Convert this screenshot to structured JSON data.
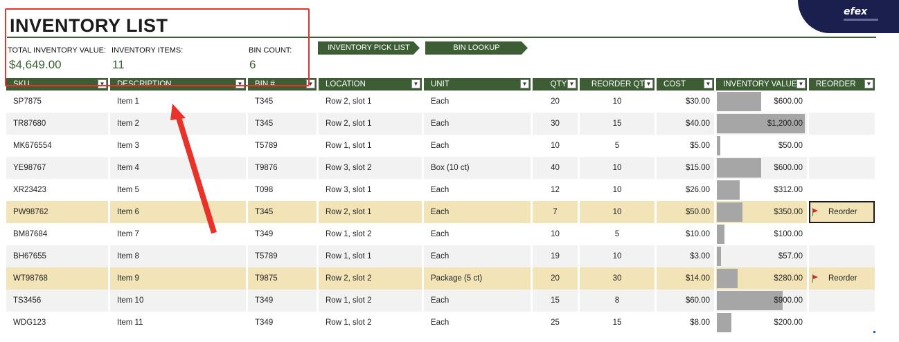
{
  "brand": {
    "logo_text": "efex"
  },
  "title": "INVENTORY LIST",
  "stats": {
    "total_value_label": "TOTAL INVENTORY VALUE:",
    "total_value": "$4,649.00",
    "items_label": "INVENTORY ITEMS:",
    "items": "11",
    "bins_label": "BIN COUNT:",
    "bins": "6"
  },
  "nav": {
    "pick_list": "INVENTORY PICK LIST",
    "bin_lookup": "BIN LOOKUP"
  },
  "colors": {
    "header_green": "#3d5e35",
    "reorder_row": "#f2e4b7",
    "annotation_red": "#e8332a",
    "logo_navy": "#1a1f4d"
  },
  "table": {
    "headers": [
      "SKU",
      "DESCRIPTION",
      "BIN #",
      "LOCATION",
      "UNIT",
      "QTY",
      "REORDER QTY",
      "COST",
      "INVENTORY VALUE",
      "REORDER"
    ],
    "max_value": 1200,
    "rows": [
      {
        "sku": "SP7875",
        "desc": "Item 1",
        "bin": "T345",
        "loc": "Row 2, slot 1",
        "unit": "Each",
        "qty": "20",
        "rqty": "10",
        "cost": "$30.00",
        "value": "$600.00",
        "value_num": 600,
        "reorder": ""
      },
      {
        "sku": "TR87680",
        "desc": "Item 2",
        "bin": "T345",
        "loc": "Row 2, slot 1",
        "unit": "Each",
        "qty": "30",
        "rqty": "15",
        "cost": "$40.00",
        "value": "$1,200.00",
        "value_num": 1200,
        "reorder": ""
      },
      {
        "sku": "MK676554",
        "desc": "Item 3",
        "bin": "T5789",
        "loc": "Row 1, slot 1",
        "unit": "Each",
        "qty": "10",
        "rqty": "5",
        "cost": "$5.00",
        "value": "$50.00",
        "value_num": 50,
        "reorder": ""
      },
      {
        "sku": "YE98767",
        "desc": "Item 4",
        "bin": "T9876",
        "loc": "Row 3, slot 2",
        "unit": "Box (10 ct)",
        "qty": "40",
        "rqty": "10",
        "cost": "$15.00",
        "value": "$600.00",
        "value_num": 600,
        "reorder": ""
      },
      {
        "sku": "XR23423",
        "desc": "Item 5",
        "bin": "T098",
        "loc": "Row 3, slot 1",
        "unit": "Each",
        "qty": "12",
        "rqty": "10",
        "cost": "$26.00",
        "value": "$312.00",
        "value_num": 312,
        "reorder": ""
      },
      {
        "sku": "PW98762",
        "desc": "Item 6",
        "bin": "T345",
        "loc": "Row 2, slot 1",
        "unit": "Each",
        "qty": "7",
        "rqty": "10",
        "cost": "$50.00",
        "value": "$350.00",
        "value_num": 350,
        "reorder": "Reorder"
      },
      {
        "sku": "BM87684",
        "desc": "Item 7",
        "bin": "T349",
        "loc": "Row 1, slot 2",
        "unit": "Each",
        "qty": "10",
        "rqty": "5",
        "cost": "$10.00",
        "value": "$100.00",
        "value_num": 100,
        "reorder": ""
      },
      {
        "sku": "BH67655",
        "desc": "Item 8",
        "bin": "T5789",
        "loc": "Row 1, slot 1",
        "unit": "Each",
        "qty": "19",
        "rqty": "10",
        "cost": "$3.00",
        "value": "$57.00",
        "value_num": 57,
        "reorder": ""
      },
      {
        "sku": "WT98768",
        "desc": "Item 9",
        "bin": "T9875",
        "loc": "Row 2, slot 2",
        "unit": "Package (5 ct)",
        "qty": "20",
        "rqty": "30",
        "cost": "$14.00",
        "value": "$280.00",
        "value_num": 280,
        "reorder": "Reorder"
      },
      {
        "sku": "TS3456",
        "desc": "Item 10",
        "bin": "T349",
        "loc": "Row 1, slot 2",
        "unit": "Each",
        "qty": "15",
        "rqty": "8",
        "cost": "$60.00",
        "value": "$900.00",
        "value_num": 900,
        "reorder": ""
      },
      {
        "sku": "WDG123",
        "desc": "Item 11",
        "bin": "T349",
        "loc": "Row 1, slot 2",
        "unit": "Each",
        "qty": "25",
        "rqty": "15",
        "cost": "$8.00",
        "value": "$200.00",
        "value_num": 200,
        "reorder": ""
      }
    ]
  }
}
